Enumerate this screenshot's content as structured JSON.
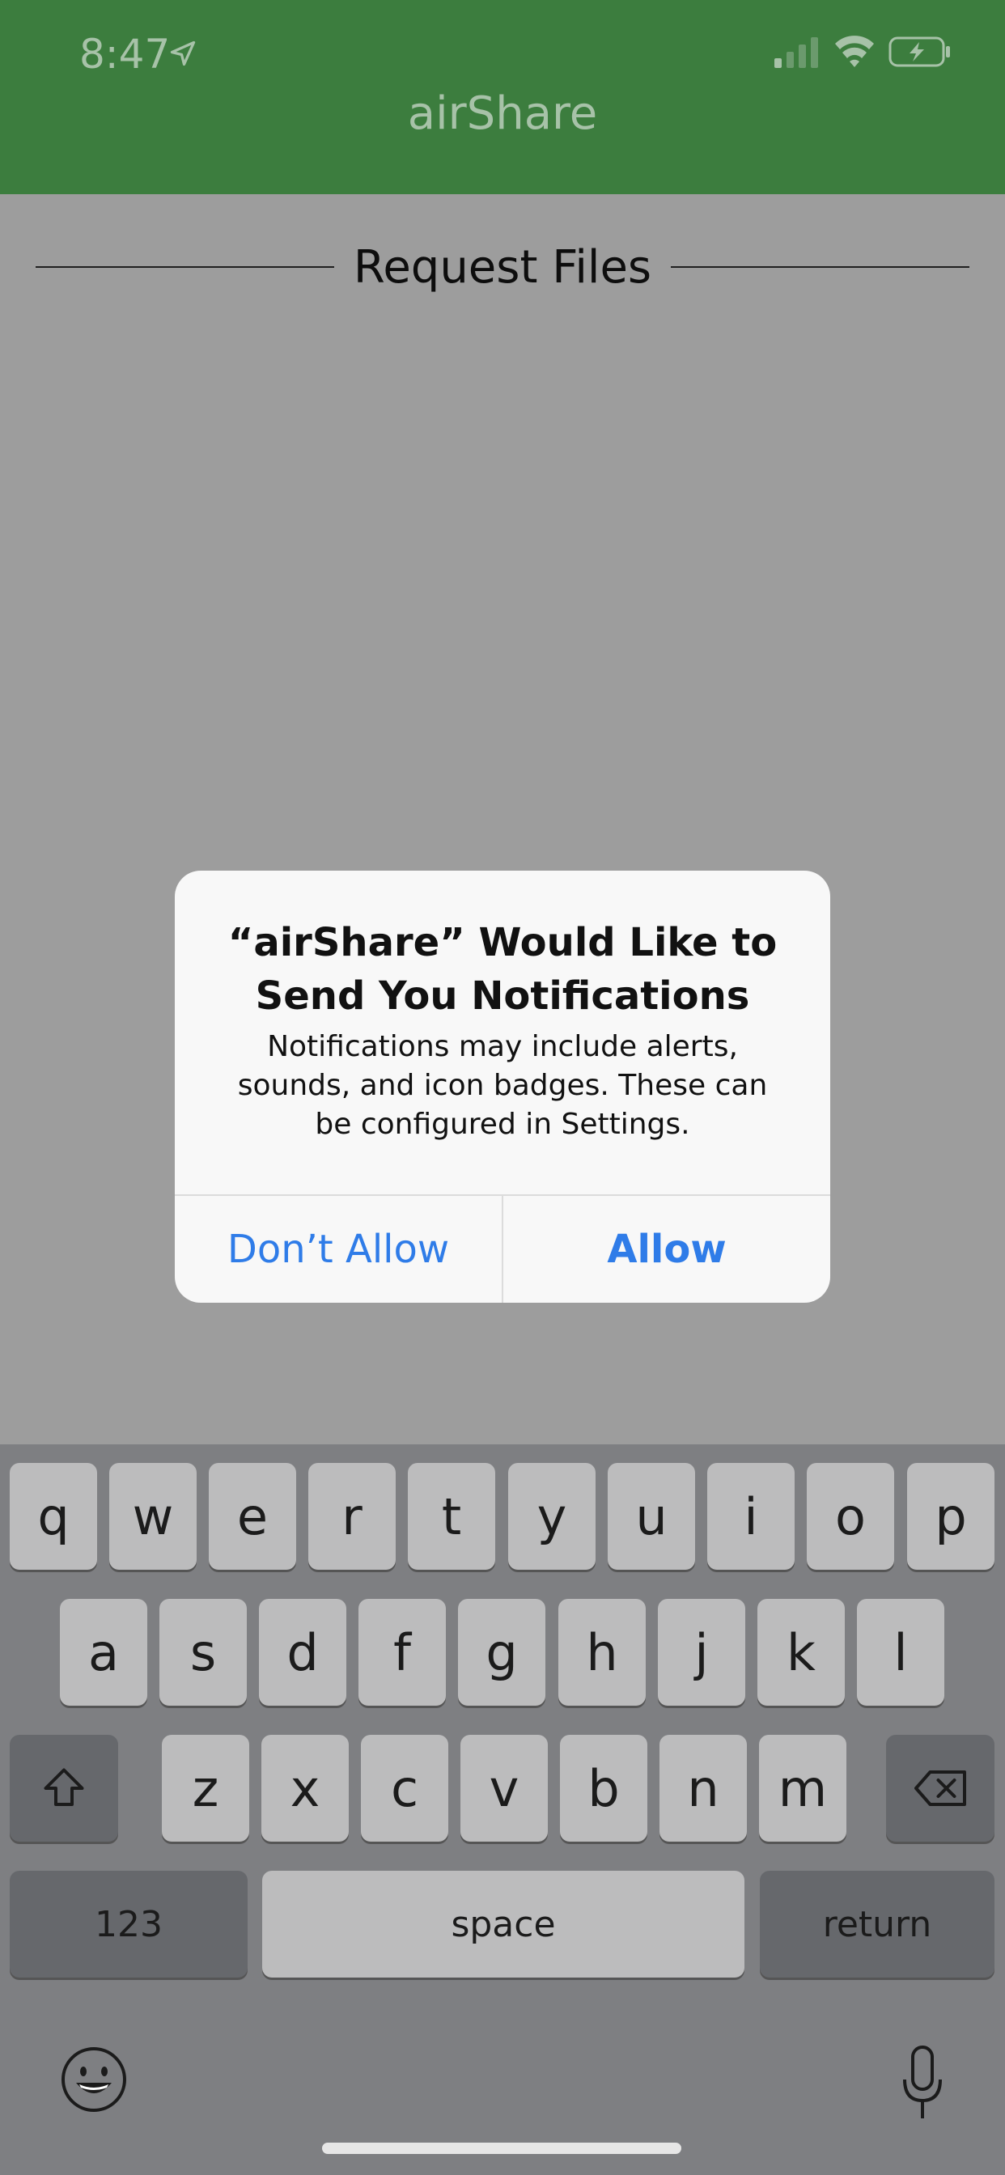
{
  "status_bar": {
    "time": "8:47"
  },
  "nav": {
    "title": "airShare"
  },
  "section": {
    "title": "Request Files"
  },
  "alert": {
    "title": "“airShare” Would Like to Send You Notifications",
    "message": "Notifications may include alerts, sounds, and icon badges. These can be configured in Settings.",
    "buttons": {
      "deny": "Don’t Allow",
      "allow": "Allow"
    }
  },
  "keyboard": {
    "row1": [
      "q",
      "w",
      "e",
      "r",
      "t",
      "y",
      "u",
      "i",
      "o",
      "p"
    ],
    "row2": [
      "a",
      "s",
      "d",
      "f",
      "g",
      "h",
      "j",
      "k",
      "l"
    ],
    "row3": [
      "z",
      "x",
      "c",
      "v",
      "b",
      "n",
      "m"
    ],
    "numbers_label": "123",
    "space_label": "space",
    "return_label": "return"
  },
  "icons": {
    "location": "location-arrow-icon",
    "signal": "cellular-signal-icon",
    "wifi": "wifi-icon",
    "battery": "battery-charging-icon",
    "shift": "shift-icon",
    "delete": "backspace-icon",
    "emoji": "emoji-icon",
    "mic": "microphone-icon"
  },
  "colors": {
    "nav_green": "#3c7d3e",
    "alert_blue": "#2f7ce8",
    "overlay_gray": "#9d9d9d",
    "keyboard_bg": "#7e7f82"
  }
}
